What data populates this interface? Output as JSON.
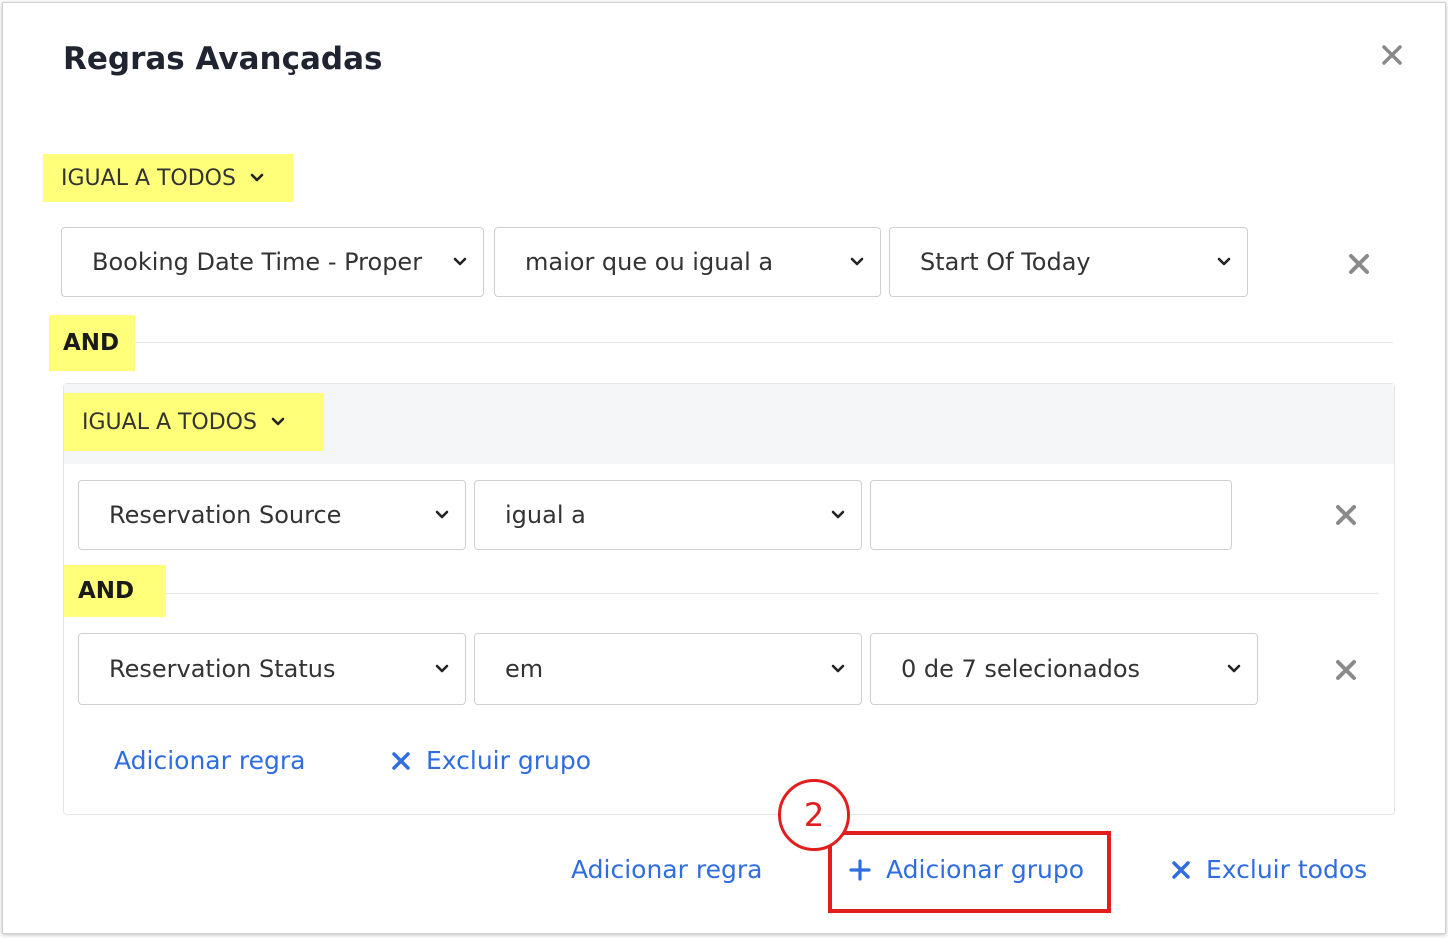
{
  "dialog": {
    "title": "Regras Avançadas",
    "close_icon": "close-icon"
  },
  "root": {
    "combinator": "IGUAL A TODOS",
    "rule1": {
      "field": "Booking Date Time - Proper",
      "operator": "maior que ou igual a",
      "value": "Start Of Today"
    },
    "and_label": "AND",
    "group": {
      "combinator": "IGUAL A TODOS",
      "rule1": {
        "field": "Reservation Source",
        "operator": "igual a",
        "value": ""
      },
      "and_label": "AND",
      "rule2": {
        "field": "Reservation Status",
        "operator": "em",
        "value": "0 de 7 selecionados"
      },
      "add_rule": "Adicionar regra",
      "delete_group": "Excluir grupo"
    },
    "add_rule": "Adicionar regra",
    "add_group": "Adicionar grupo",
    "delete_all": "Excluir todos"
  },
  "annotation": {
    "step_number": "2"
  },
  "colors": {
    "accent": "#2f6de1",
    "highlight": "#ffff7a",
    "annotation": "#e11d1d"
  }
}
